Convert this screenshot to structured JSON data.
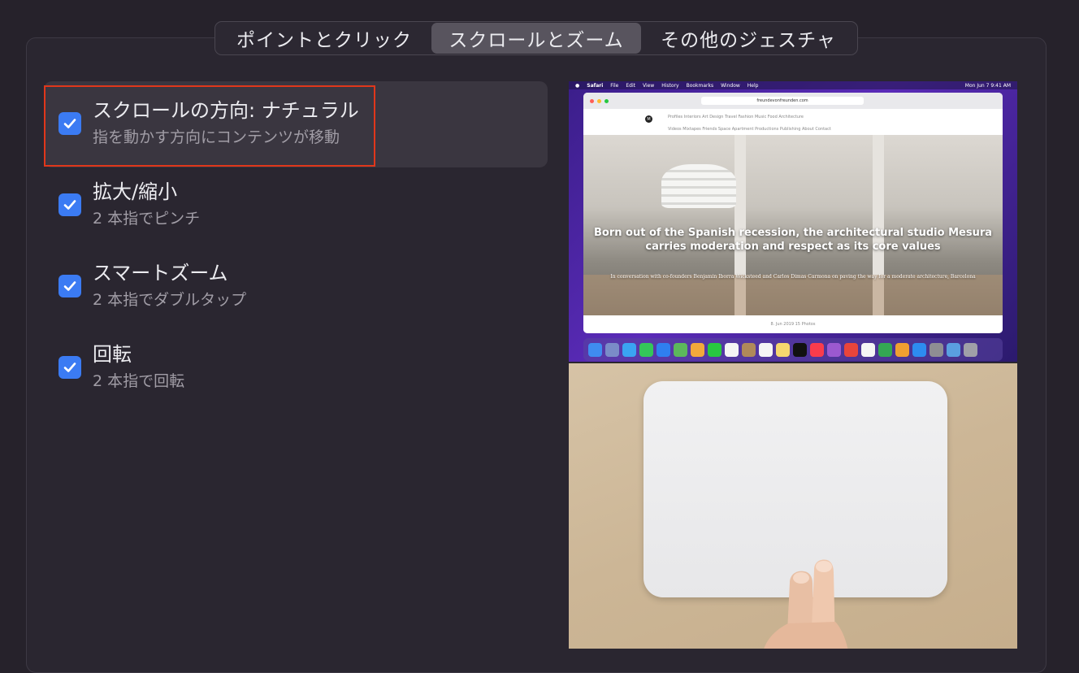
{
  "tabs": [
    {
      "label": "ポイントとクリック",
      "selected": false
    },
    {
      "label": "スクロールとズーム",
      "selected": true
    },
    {
      "label": "その他のジェスチャ",
      "selected": false
    }
  ],
  "options": [
    {
      "title": "スクロールの方向: ナチュラル",
      "subtitle": "指を動かす方向にコンテンツが移動",
      "checked": true,
      "selected": true
    },
    {
      "title": "拡大/縮小",
      "subtitle": "2 本指でピンチ",
      "checked": true,
      "selected": false
    },
    {
      "title": "スマートズーム",
      "subtitle": "2 本指でダブルタップ",
      "checked": true,
      "selected": false
    },
    {
      "title": "回転",
      "subtitle": "2 本指で回転",
      "checked": true,
      "selected": false
    }
  ],
  "preview": {
    "menubar": [
      "Safari",
      "File",
      "Edit",
      "View",
      "History",
      "Bookmarks",
      "Window",
      "Help"
    ],
    "clock": "Mon Jun 7  9:41 AM",
    "url": "freundevonfreunden.com",
    "logo": "M",
    "nav_row1": "Profiles   Interiors   Art   Design   Travel   Fashion   Music   Food   Architecture",
    "nav_row2": "Videos   Mixtapes   Friends Space   Apartment   Productions   Publishing   About   Contact",
    "headline": "Born out of the Spanish recession, the architectural studio Mesura carries moderation and respect as its core values",
    "subline": "In conversation with co-founders Benjamin Iborra Wicksteed and Carlos Dimas Carmona on paving the way for a moderate architecture, Barcelona",
    "footer": "8. Jun 2019      15 Photos"
  },
  "colors": {
    "accent": "#3b7bf3",
    "highlight": "#e0371b",
    "background": "#26222b"
  }
}
